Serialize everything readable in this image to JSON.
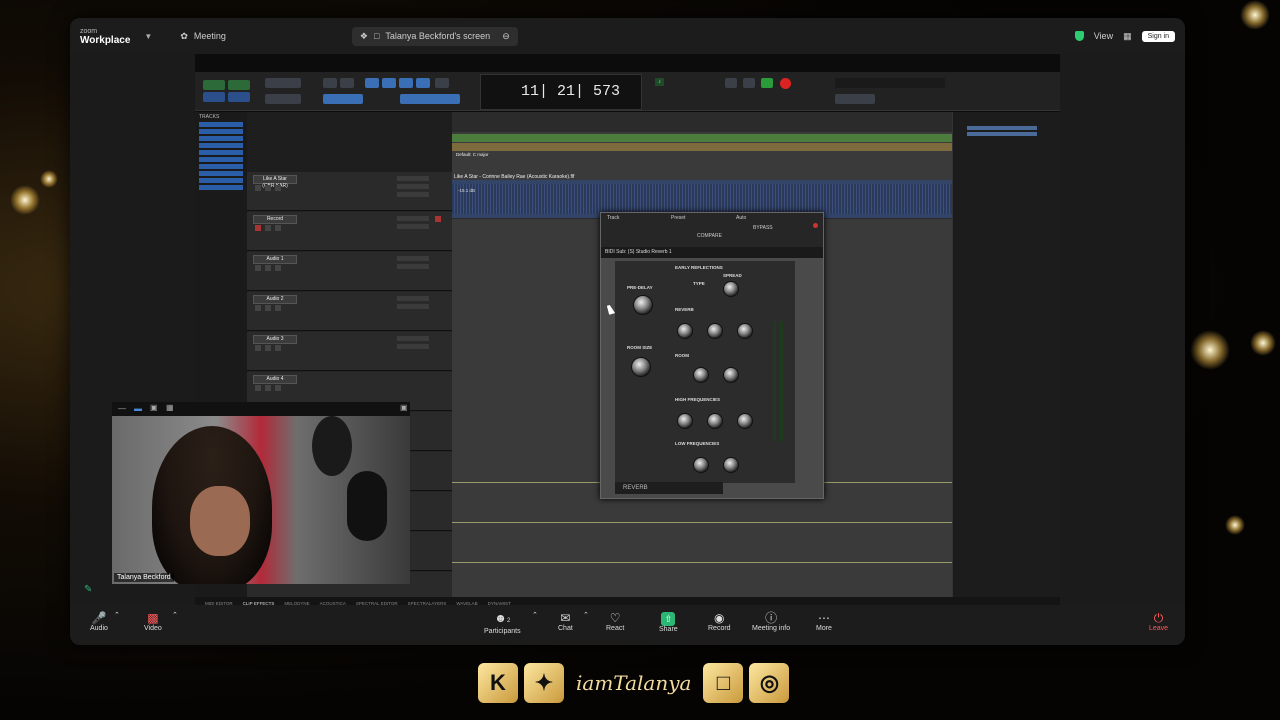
{
  "zoom": {
    "brand_top": "zoom",
    "brand_name": "Workplace",
    "tab_meeting": "Meeting",
    "tab_screen": "Talanya Beckford's screen",
    "view_label": "View",
    "signin_label": "Sign in"
  },
  "daw": {
    "counter": "11| 21| 573",
    "tracks_label": "TRACKS",
    "clip_title": "Like A Star - Corinne Bailey Rae (Acoustic Karaoke).flf",
    "clip_sub": "-15.1 dB",
    "marker_label": "Default: C major",
    "tracks": [
      {
        "name": "Like A Star (CBR.KAR)"
      },
      {
        "name": "Record"
      },
      {
        "name": "Audio 1"
      },
      {
        "name": "Audio 2"
      },
      {
        "name": "Audio 3"
      },
      {
        "name": "Audio 4"
      }
    ],
    "bottom_tabs": [
      "MIDI EDITOR",
      "CLIP EFFECTS",
      "MELODYNE",
      "ACOUSTICA",
      "SPECTRAL EDITOR",
      "SPECTRALAYERS",
      "WAVELAB",
      "DYNAMIST"
    ]
  },
  "plugin": {
    "track_label": "Track",
    "preset_label": "Preset",
    "auto_label": "Auto",
    "compare_label": "COMPARE",
    "bypass_label": "BYPASS",
    "title": "BIDI Sub: (S) Studio Reverb 1",
    "early_reflections": "EARLY REFLECTIONS",
    "type_label": "TYPE",
    "spread_label": "SPREAD",
    "predelay_label": "PRE-DELAY",
    "reverb_label": "REVERB",
    "room_size_label": "ROOM SIZE",
    "room_label": "ROOM",
    "high_freq_label": "HIGH FREQUENCIES",
    "low_freq_label": "LOW FREQUENCIES",
    "footer": "REVERB"
  },
  "webcam": {
    "name": "Talanya Beckford"
  },
  "toolbar": {
    "audio": "Audio",
    "video": "Video",
    "participants": "Participants",
    "participants_count": "2",
    "chat": "Chat",
    "react": "React",
    "share": "Share",
    "record": "Record",
    "meeting_info": "Meeting info",
    "more": "More",
    "leave": "Leave"
  },
  "social": {
    "handle": "iamTalanya"
  }
}
